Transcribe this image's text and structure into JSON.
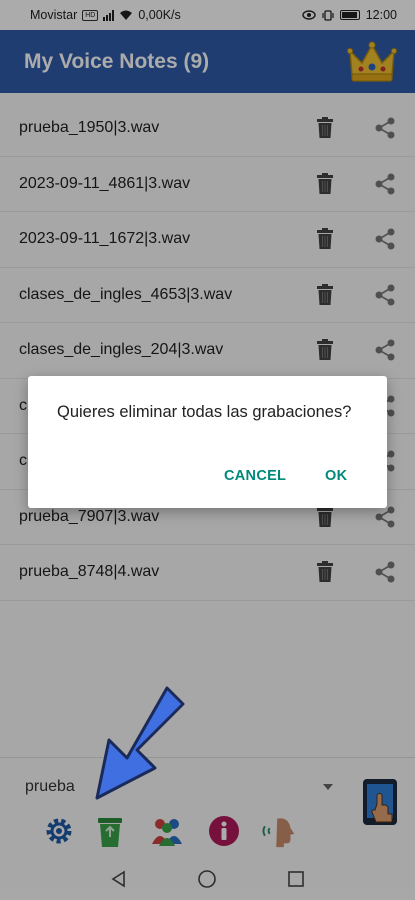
{
  "status_bar": {
    "carrier": "Movistar",
    "hd_badge": "HD",
    "net_speed": "0,00K/s",
    "time": "12:00"
  },
  "app_bar": {
    "title": "My Voice Notes (9)",
    "premium_icon": "crown-icon"
  },
  "recordings": [
    {
      "name": "prueba_1950|3.wav"
    },
    {
      "name": "2023-09-11_4861|3.wav"
    },
    {
      "name": "2023-09-11_1672|3.wav"
    },
    {
      "name": "clases_de_ingles_4653|3.wav"
    },
    {
      "name": "clases_de_ingles_204|3.wav"
    },
    {
      "name": "c"
    },
    {
      "name": "c"
    },
    {
      "name": "prueba_7907|3.wav"
    },
    {
      "name": "prueba_8748|4.wav"
    }
  ],
  "row_icons": {
    "delete": "trash-icon",
    "share": "share-icon"
  },
  "bottom_bar": {
    "filter_value": "prueba",
    "tools": [
      "gear-icon",
      "recycle-bin-icon",
      "people-icon",
      "info-icon",
      "voice-icon"
    ],
    "tablet_icon": "tablet-touch-icon"
  },
  "dialog": {
    "message": "Quieres eliminar todas las grabaciones?",
    "cancel_label": "CANCEL",
    "ok_label": "OK"
  },
  "colors": {
    "app_bar": "#2f5ba8",
    "dialog_accent": "#00897b",
    "arrow": "#3f6fe0"
  }
}
